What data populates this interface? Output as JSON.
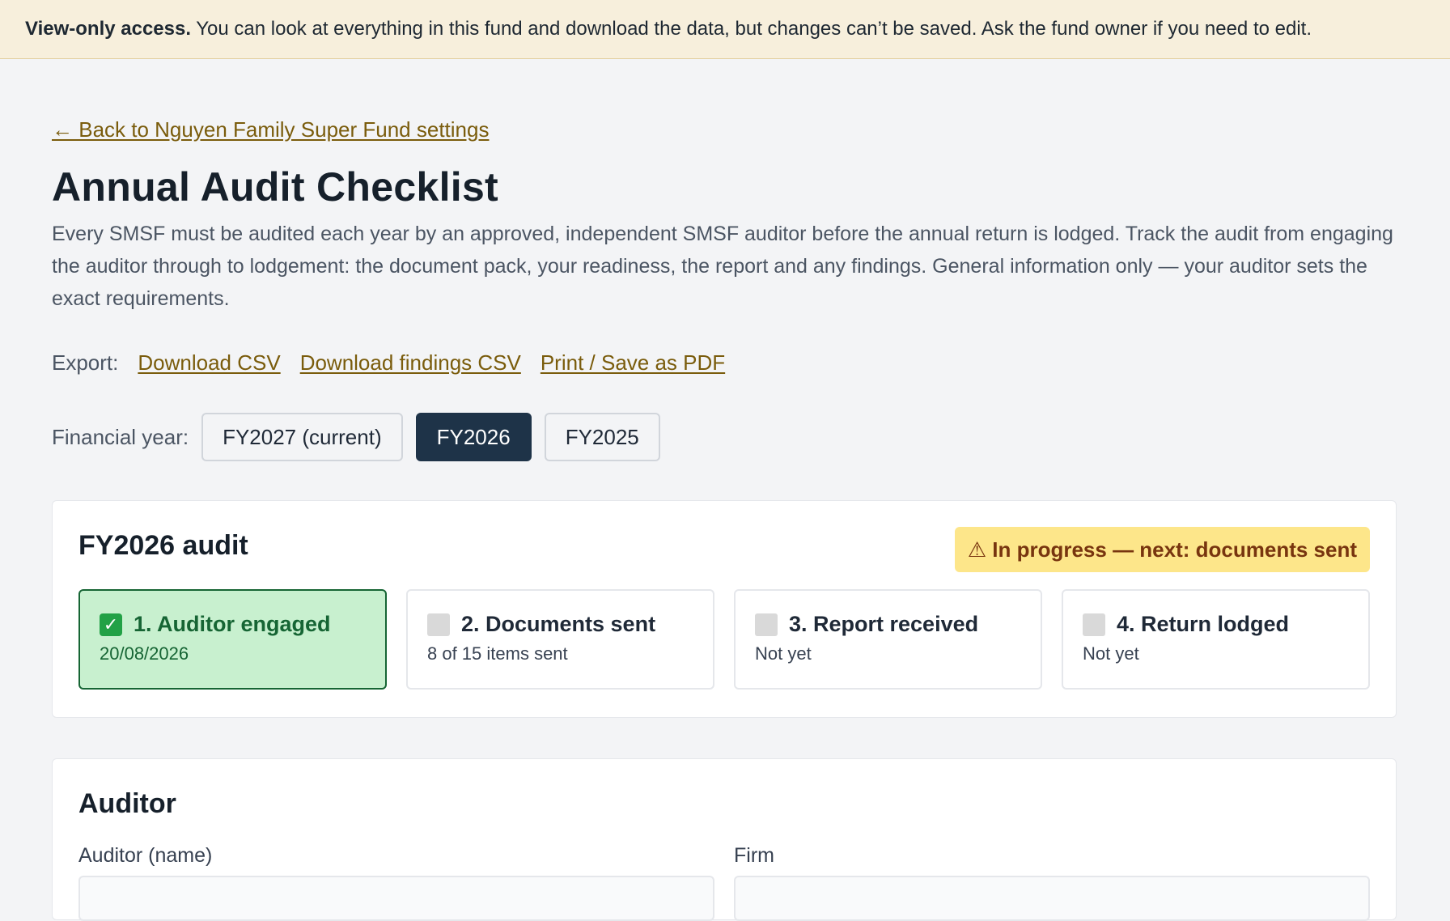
{
  "banner": {
    "strong": "View-only access.",
    "message": " You can look at everything in this fund and download the data, but changes can’t be saved. Ask the fund owner if you need to edit."
  },
  "back_link": "← Back to Nguyen Family Super Fund settings",
  "page": {
    "title": "Annual Audit Checklist",
    "intro": "Every SMSF must be audited each year by an approved, independent SMSF auditor before the annual return is lodged. Track the audit from engaging the auditor through to lodgement: the document pack, your readiness, the report and any findings. General information only — your auditor sets the exact requirements."
  },
  "export": {
    "label": "Export:",
    "links": [
      "Download CSV",
      "Download findings CSV",
      "Print / Save as PDF"
    ]
  },
  "financial_year": {
    "label": "Financial year:",
    "options": [
      "FY2027 (current)",
      "FY2026",
      "FY2025"
    ],
    "selected": "FY2026"
  },
  "audit": {
    "title": "FY2026 audit",
    "status_icon": "warning-icon",
    "status": "⚠ In progress — next: documents sent",
    "steps": [
      {
        "label": "1. Auditor engaged",
        "sub": "20/08/2026",
        "done": true
      },
      {
        "label": "2. Documents sent",
        "sub": "8 of 15 items sent",
        "done": false
      },
      {
        "label": "3. Report received",
        "sub": "Not yet",
        "done": false
      },
      {
        "label": "4. Return lodged",
        "sub": "Not yet",
        "done": false
      }
    ]
  },
  "auditor": {
    "title": "Auditor",
    "name_label": "Auditor (name)",
    "name_value": "",
    "firm_label": "Firm",
    "firm_value": ""
  },
  "colors": {
    "accent_link": "#7a5c0c",
    "selected_tab": "#1e3348",
    "done_step": "#c8f0cf",
    "status_badge": "#fde68a"
  }
}
